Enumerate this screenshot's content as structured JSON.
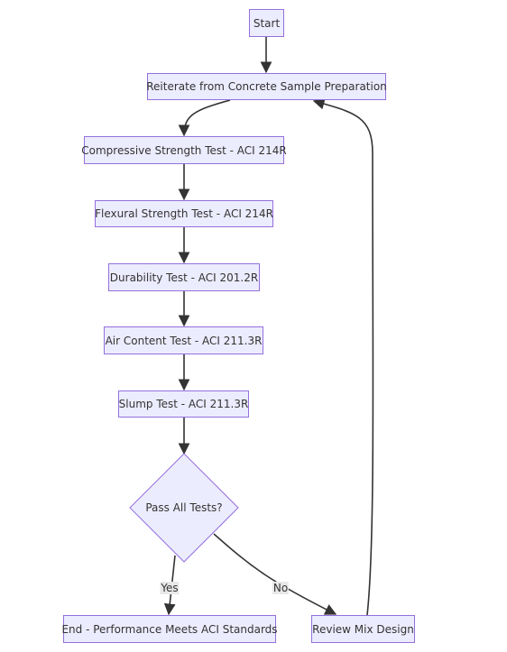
{
  "diagram": {
    "type": "flowchart",
    "colors": {
      "node_fill": "#ececff",
      "node_stroke": "#9370db",
      "edge": "#333333",
      "text": "#333333",
      "edge_label_bg": "#e8e8e8"
    },
    "nodes": {
      "start": "Start",
      "reiterate": "Reiterate from Concrete Sample Preparation",
      "compressive": "Compressive Strength Test - ACI 214R",
      "flexural": "Flexural Strength Test - ACI 214R",
      "durability": "Durability Test - ACI 201.2R",
      "air_content": "Air Content Test - ACI 211.3R",
      "slump": "Slump Test - ACI 211.3R",
      "decision": "Pass All Tests?",
      "end": "End - Performance Meets ACI Standards",
      "review": "Review Mix Design"
    },
    "edges": [
      {
        "from": "start",
        "to": "reiterate",
        "label": ""
      },
      {
        "from": "reiterate",
        "to": "compressive",
        "label": ""
      },
      {
        "from": "compressive",
        "to": "flexural",
        "label": ""
      },
      {
        "from": "flexural",
        "to": "durability",
        "label": ""
      },
      {
        "from": "durability",
        "to": "air_content",
        "label": ""
      },
      {
        "from": "air_content",
        "to": "slump",
        "label": ""
      },
      {
        "from": "slump",
        "to": "decision",
        "label": ""
      },
      {
        "from": "decision",
        "to": "end",
        "label": "Yes"
      },
      {
        "from": "decision",
        "to": "review",
        "label": "No"
      },
      {
        "from": "review",
        "to": "reiterate",
        "label": ""
      }
    ],
    "edge_labels": {
      "yes": "Yes",
      "no": "No"
    }
  }
}
